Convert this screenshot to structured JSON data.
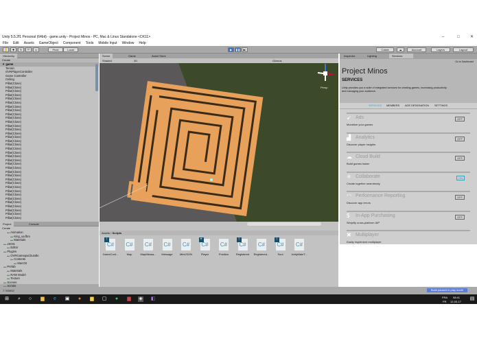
{
  "window": {
    "title": "Unity 5.5.2f1 Personal (64bit) - game.unity - Project Minos - PC, Mac & Linux Standalone <DX11>",
    "minimize": "–",
    "maximize": "□",
    "close": "✕"
  },
  "menu": [
    "File",
    "Edit",
    "Assets",
    "GameObject",
    "Component",
    "Tools",
    "Mobile Input",
    "Window",
    "Help"
  ],
  "toolbar": {
    "pivot": "Pivot",
    "local": "Local",
    "collab": "Collab",
    "account": "Account",
    "layers": "Layers",
    "layout": "Layout"
  },
  "hierarchy": {
    "tab": "Hierarchy",
    "create": "Create",
    "root": "game",
    "items": [
      "Terrain",
      "OVRPlayerController",
      "Game Controller",
      "Ceiling",
      "Pillar(Clone)",
      "Pillar(Clone)",
      "Pillar(Clone)",
      "Pillar(Clone)",
      "Pillar(Clone)",
      "Pillar(Clone)",
      "Pillar(Clone)",
      "Pillar(Clone)",
      "Pillar(Clone)",
      "Pillar(Clone)",
      "Pillar(Clone)",
      "Pillar(Clone)",
      "Pillar(Clone)",
      "Pillar(Clone)",
      "Pillar(Clone)",
      "Pillar(Clone)",
      "Pillar(Clone)",
      "Pillar(Clone)",
      "Pillar(Clone)",
      "Pillar(Clone)",
      "Pillar(Clone)",
      "Pillar(Clone)",
      "Pillar(Clone)",
      "Pillar(Clone)",
      "Pillar(Clone)",
      "Pillar(Clone)",
      "Pillar(Clone)",
      "Pillar(Clone)",
      "Pillar(Clone)",
      "Pillar(Clone)",
      "Pillar(Clone)",
      "Pillar(Clone)",
      "Pillar(Clone)",
      "Pillar(Clone)",
      "Pillar(Clone)",
      "Pillar(Clone)"
    ]
  },
  "scene": {
    "tabs": [
      "Scene",
      "Game",
      "Asset Store"
    ],
    "shading": "Shaded",
    "mode": "2D",
    "gizmos": "Gizmos",
    "persp": "Persp"
  },
  "inspector": {
    "tabs": [
      "Inspector",
      "Lighting",
      "Services"
    ],
    "dashboard": "Go to Dashboard",
    "project": "Project Minos",
    "section": "SERVICES",
    "intro": "Unity provides you a suite of integrated services for creating games, increasing productivity and managing your audience.",
    "subtabs": [
      "SERVICES",
      "MEMBERS",
      "AGE DESIGNATION",
      "SETTINGS"
    ],
    "services": [
      {
        "name": "Ads",
        "desc": "Monetize your games",
        "state": "OFF",
        "icon": "megaphone-icon"
      },
      {
        "name": "Analytics",
        "desc": "Discover player insights",
        "state": "OFF",
        "icon": "chart-icon"
      },
      {
        "name": "Cloud Build",
        "desc": "Build games faster",
        "state": "OFF",
        "icon": "cloud-icon"
      },
      {
        "name": "Collaborate",
        "desc": "Create together seamlessly",
        "state": "ON",
        "icon": "collab-icon"
      },
      {
        "name": "Performance Reporting",
        "desc": "Discover app errors",
        "state": "OFF",
        "icon": "gauge-icon"
      },
      {
        "name": "In-App Purchasing",
        "desc": "Simplify cross-platform IAP",
        "state": "OFF",
        "icon": "dollar-icon"
      },
      {
        "name": "Multiplayer",
        "desc": "Easily implement multiplayer",
        "state": null,
        "icon": "multiplayer-icon"
      }
    ]
  },
  "project": {
    "tabs": [
      "Project",
      "Console"
    ],
    "create": "Create",
    "tree": [
      "Animation",
      "King_ua.fbm",
      "Materials",
      "JSON",
      "Editor",
      "Plugins",
      "OVRGamepad.bundle",
      "Contents",
      "MacOS",
      "Prefab",
      "Materials",
      "RAW Model",
      "Texture",
      "Scenes",
      "Scripts"
    ],
    "breadcrumb": [
      "Assets",
      "Scripts"
    ],
    "assets": [
      {
        "name": "GameCont...",
        "badge": "↑"
      },
      {
        "name": "Map",
        "badge": ""
      },
      {
        "name": "MapMessa...",
        "badge": ""
      },
      {
        "name": "Message",
        "badge": ""
      },
      {
        "name": "MiniJSON",
        "badge": ""
      },
      {
        "name": "Player",
        "badge": "+"
      },
      {
        "name": "Position",
        "badge": ""
      },
      {
        "name": "Registered",
        "badge": "↑"
      },
      {
        "name": "Registered...",
        "badge": ""
      },
      {
        "name": "Soul",
        "badge": "↑"
      },
      {
        "name": "UnityMainT...",
        "badge": ""
      }
    ]
  },
  "status": {
    "left": "7.760002",
    "right": "Build paused in play mode"
  },
  "taskbar": {
    "lang": "FRA",
    "region": "FR",
    "time": "08:41",
    "date": "12-03-17"
  }
}
